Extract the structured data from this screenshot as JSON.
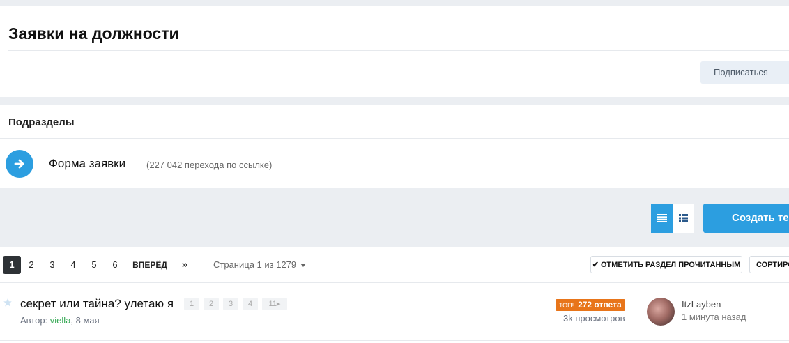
{
  "header": {
    "title": "Заявки на должности",
    "subscribe_label": "Подписаться"
  },
  "subforums": {
    "title": "Подразделы",
    "items": [
      {
        "label": "Форма заявки",
        "count": "(227 042 перехода по ссылке)"
      }
    ]
  },
  "toolbar": {
    "create_label": "Создать тему"
  },
  "pagination": {
    "pages": [
      "1",
      "2",
      "3",
      "4",
      "5",
      "6"
    ],
    "active": "1",
    "next_label": "ВПЕРЁД",
    "last_label": "»",
    "page_info": "Страница 1 из 1279",
    "mark_read_label": "✔ ОТМЕТИТЬ РАЗДЕЛ ПРОЧИТАННЫМ",
    "sort_label": "СОРТИРОВКА"
  },
  "threads": [
    {
      "title": "секрет или тайна? улетаю я",
      "mini_pages": [
        "1",
        "2",
        "3",
        "4",
        "11▸"
      ],
      "author_prefix": "Автор: ",
      "author": "viella",
      "date": ", 8 мая",
      "badge_top": "ТОП!",
      "replies": "272 ответа",
      "views": "3k просмотров",
      "last_user": "ItzLayben",
      "last_time": "1 минута назад"
    }
  ],
  "colors": {
    "accent": "#2c9ee0",
    "badge": "#e8751a",
    "author": "#34a853"
  }
}
